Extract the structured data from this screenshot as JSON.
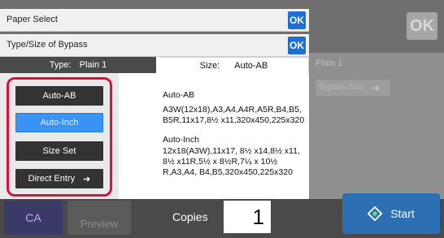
{
  "header": {
    "paper_select": "Paper Select",
    "type_size_bypass": "Type/Size of Bypass",
    "ok": "OK"
  },
  "tabs": {
    "type_label": "Type:",
    "type_value": "Plain 1",
    "size_label": "Size:",
    "size_value": "Auto-AB"
  },
  "buttons": {
    "auto_ab": "Auto-AB",
    "auto_inch": "Auto-Inch",
    "size_set": "Size Set",
    "direct_entry": "Direct Entry"
  },
  "details": {
    "auto_ab_title": "Auto-AB",
    "auto_ab_sizes": "A3W(12x18),A3,A4,A4R,A5R,B4,B5, B5R,11x17,8½ x11,320x450,225x320",
    "auto_inch_title": "Auto-Inch",
    "auto_inch_sizes": "12x18(A3W),11x17, 8½ x14,8½ x11, 8½ x11R,5½ x 8½R,7¼ x 10½ R,A3,A4, B4,B5,320x450,225x320"
  },
  "background": {
    "ok": "OK",
    "plain_tag": "Plain 1",
    "size_row": "Bypass Size"
  },
  "bottom_bar": {
    "ca": "CA",
    "preview": "Preview",
    "copies_label": "Copies",
    "copies_value": "1",
    "start": "Start"
  },
  "colors": {
    "ok_blue": "#1e6ed3",
    "selected_blue": "#3a92f5",
    "highlight_red": "#d4143c",
    "start_blue": "#2d6fb3"
  }
}
